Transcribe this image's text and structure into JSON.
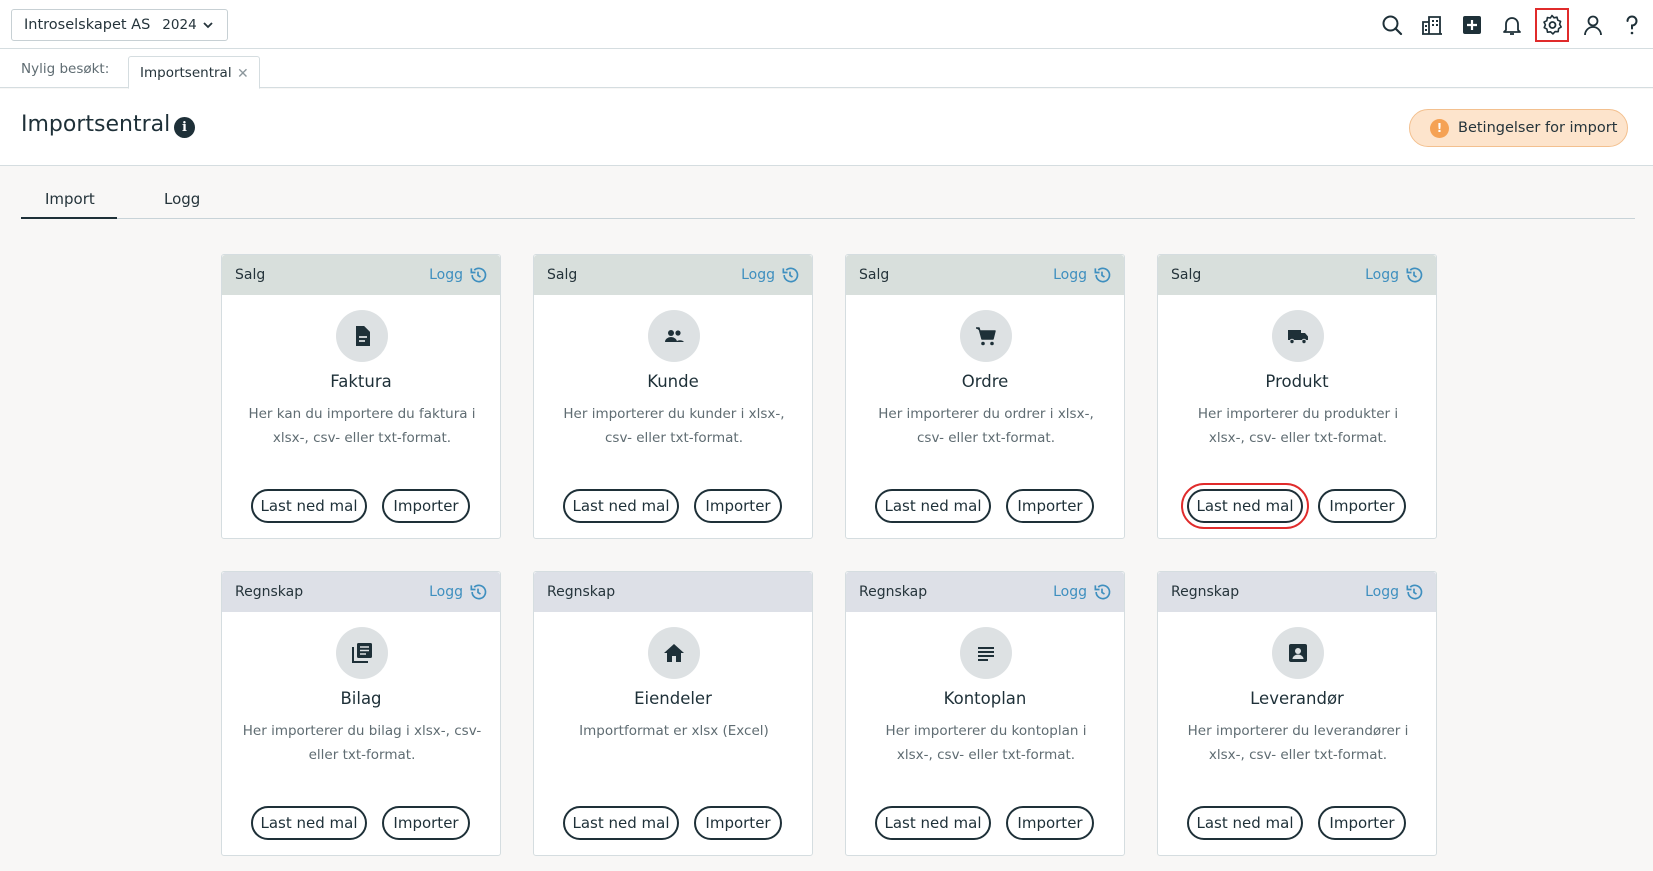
{
  "topbar": {
    "company": "Introselskapet AS",
    "year": "2024"
  },
  "recent": {
    "label": "Nylig besøkt:",
    "tab": "Importsentral"
  },
  "header": {
    "title": "Importsentral",
    "conditions_button": "Betingelser for import"
  },
  "tabs": [
    "Import",
    "Logg"
  ],
  "cards": [
    {
      "category": "Salg",
      "logg": "Logg",
      "icon": "document-icon",
      "title": "Faktura",
      "desc": "Her kan du importere du faktura i xlsx-, csv- eller txt-format.",
      "download": "Last ned mal",
      "import": "Importer"
    },
    {
      "category": "Salg",
      "logg": "Logg",
      "icon": "people-icon",
      "title": "Kunde",
      "desc": "Her importerer du kunder i xlsx-, csv- eller txt-format.",
      "download": "Last ned mal",
      "import": "Importer"
    },
    {
      "category": "Salg",
      "logg": "Logg",
      "icon": "cart-icon",
      "title": "Ordre",
      "desc": "Her importerer du ordrer i xlsx-, csv- eller txt-format.",
      "download": "Last ned mal",
      "import": "Importer"
    },
    {
      "category": "Salg",
      "logg": "Logg",
      "icon": "truck-icon",
      "title": "Produkt",
      "desc": "Her importerer du produkter i xlsx-, csv- eller txt-format.",
      "download": "Last ned mal",
      "import": "Importer"
    },
    {
      "category": "Regnskap",
      "logg": "Logg",
      "icon": "library-books-icon",
      "title": "Bilag",
      "desc": "Her importerer du bilag i xlsx-, csv- eller txt-format.",
      "download": "Last ned mal",
      "import": "Importer"
    },
    {
      "category": "Regnskap",
      "logg": "",
      "icon": "home-icon",
      "title": "Eiendeler",
      "desc": "Importformat er xlsx (Excel)",
      "download": "Last ned mal",
      "import": "Importer"
    },
    {
      "category": "Regnskap",
      "logg": "Logg",
      "icon": "list-lines-icon",
      "title": "Kontoplan",
      "desc": "Her importerer du kontoplan i xlsx-, csv- eller txt-format.",
      "download": "Last ned mal",
      "import": "Importer"
    },
    {
      "category": "Regnskap",
      "logg": "Logg",
      "icon": "contact-card-icon",
      "title": "Leverandør",
      "desc": "Her importerer du leverandører i xlsx-, csv- eller txt-format.",
      "download": "Last ned mal",
      "import": "Importer"
    }
  ],
  "colors": {
    "primary": "#1e3038",
    "link": "#3e8fbf",
    "highlight": "#e02b2b",
    "warning": "#f5a255"
  }
}
